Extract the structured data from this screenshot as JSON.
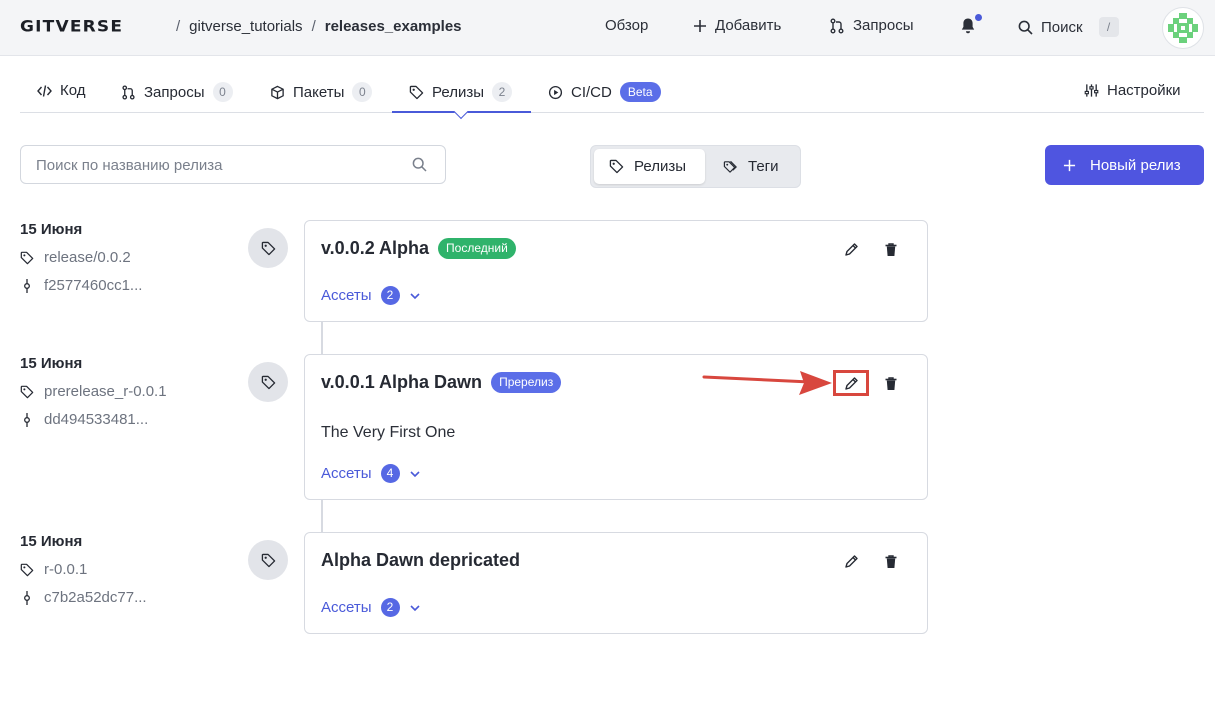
{
  "header": {
    "logo": "GITVERSE",
    "breadcrumb_owner": "gitverse_tutorials",
    "breadcrumb_sep": "/",
    "breadcrumb_repo": "releases_examples",
    "nav_overview": "Обзор",
    "nav_add": "Добавить",
    "nav_requests": "Запросы",
    "nav_search": "Поиск",
    "search_shortcut": "/"
  },
  "tabs": {
    "code": "Код",
    "requests": "Запросы",
    "requests_count": "0",
    "packages": "Пакеты",
    "packages_count": "0",
    "releases": "Релизы",
    "releases_count": "2",
    "cicd": "CI/CD",
    "cicd_badge": "Beta",
    "settings": "Настройки"
  },
  "toolbar": {
    "search_placeholder": "Поиск по названию релиза",
    "toggle_releases": "Релизы",
    "toggle_tags": "Теги",
    "new_release": "Новый релиз"
  },
  "releases": [
    {
      "date": "15 Июня",
      "tag": "release/0.0.2",
      "commit": "f2577460cc1...",
      "title": "v.0.0.2 Alpha",
      "badge": "Последний",
      "description": "",
      "assets_label": "Ассеты",
      "assets_count": "2"
    },
    {
      "date": "15 Июня",
      "tag": "prerelease_r-0.0.1",
      "commit": "dd494533481...",
      "title": "v.0.0.1 Alpha Dawn",
      "badge": "Пререлиз",
      "description": "The Very First One",
      "assets_label": "Ассеты",
      "assets_count": "4"
    },
    {
      "date": "15 Июня",
      "tag": "r-0.0.1",
      "commit": "c7b2a52dc77...",
      "title": "Alpha Dawn depricated",
      "badge": "",
      "description": "",
      "assets_label": "Ассеты",
      "assets_count": "2"
    }
  ],
  "colors": {
    "accent": "#4f55e0",
    "latest_badge": "#2fb36b",
    "prerelease_badge": "#5b6ee8",
    "annotation": "#d8473e"
  },
  "icons": [
    "code-icon",
    "pull-request-icon",
    "package-icon",
    "tag-icon",
    "play-circle-icon",
    "sliders-icon",
    "plus-icon",
    "bell-icon",
    "search-icon",
    "commit-icon",
    "pencil-icon",
    "trash-icon",
    "chevron-down-icon",
    "tags-icon"
  ]
}
